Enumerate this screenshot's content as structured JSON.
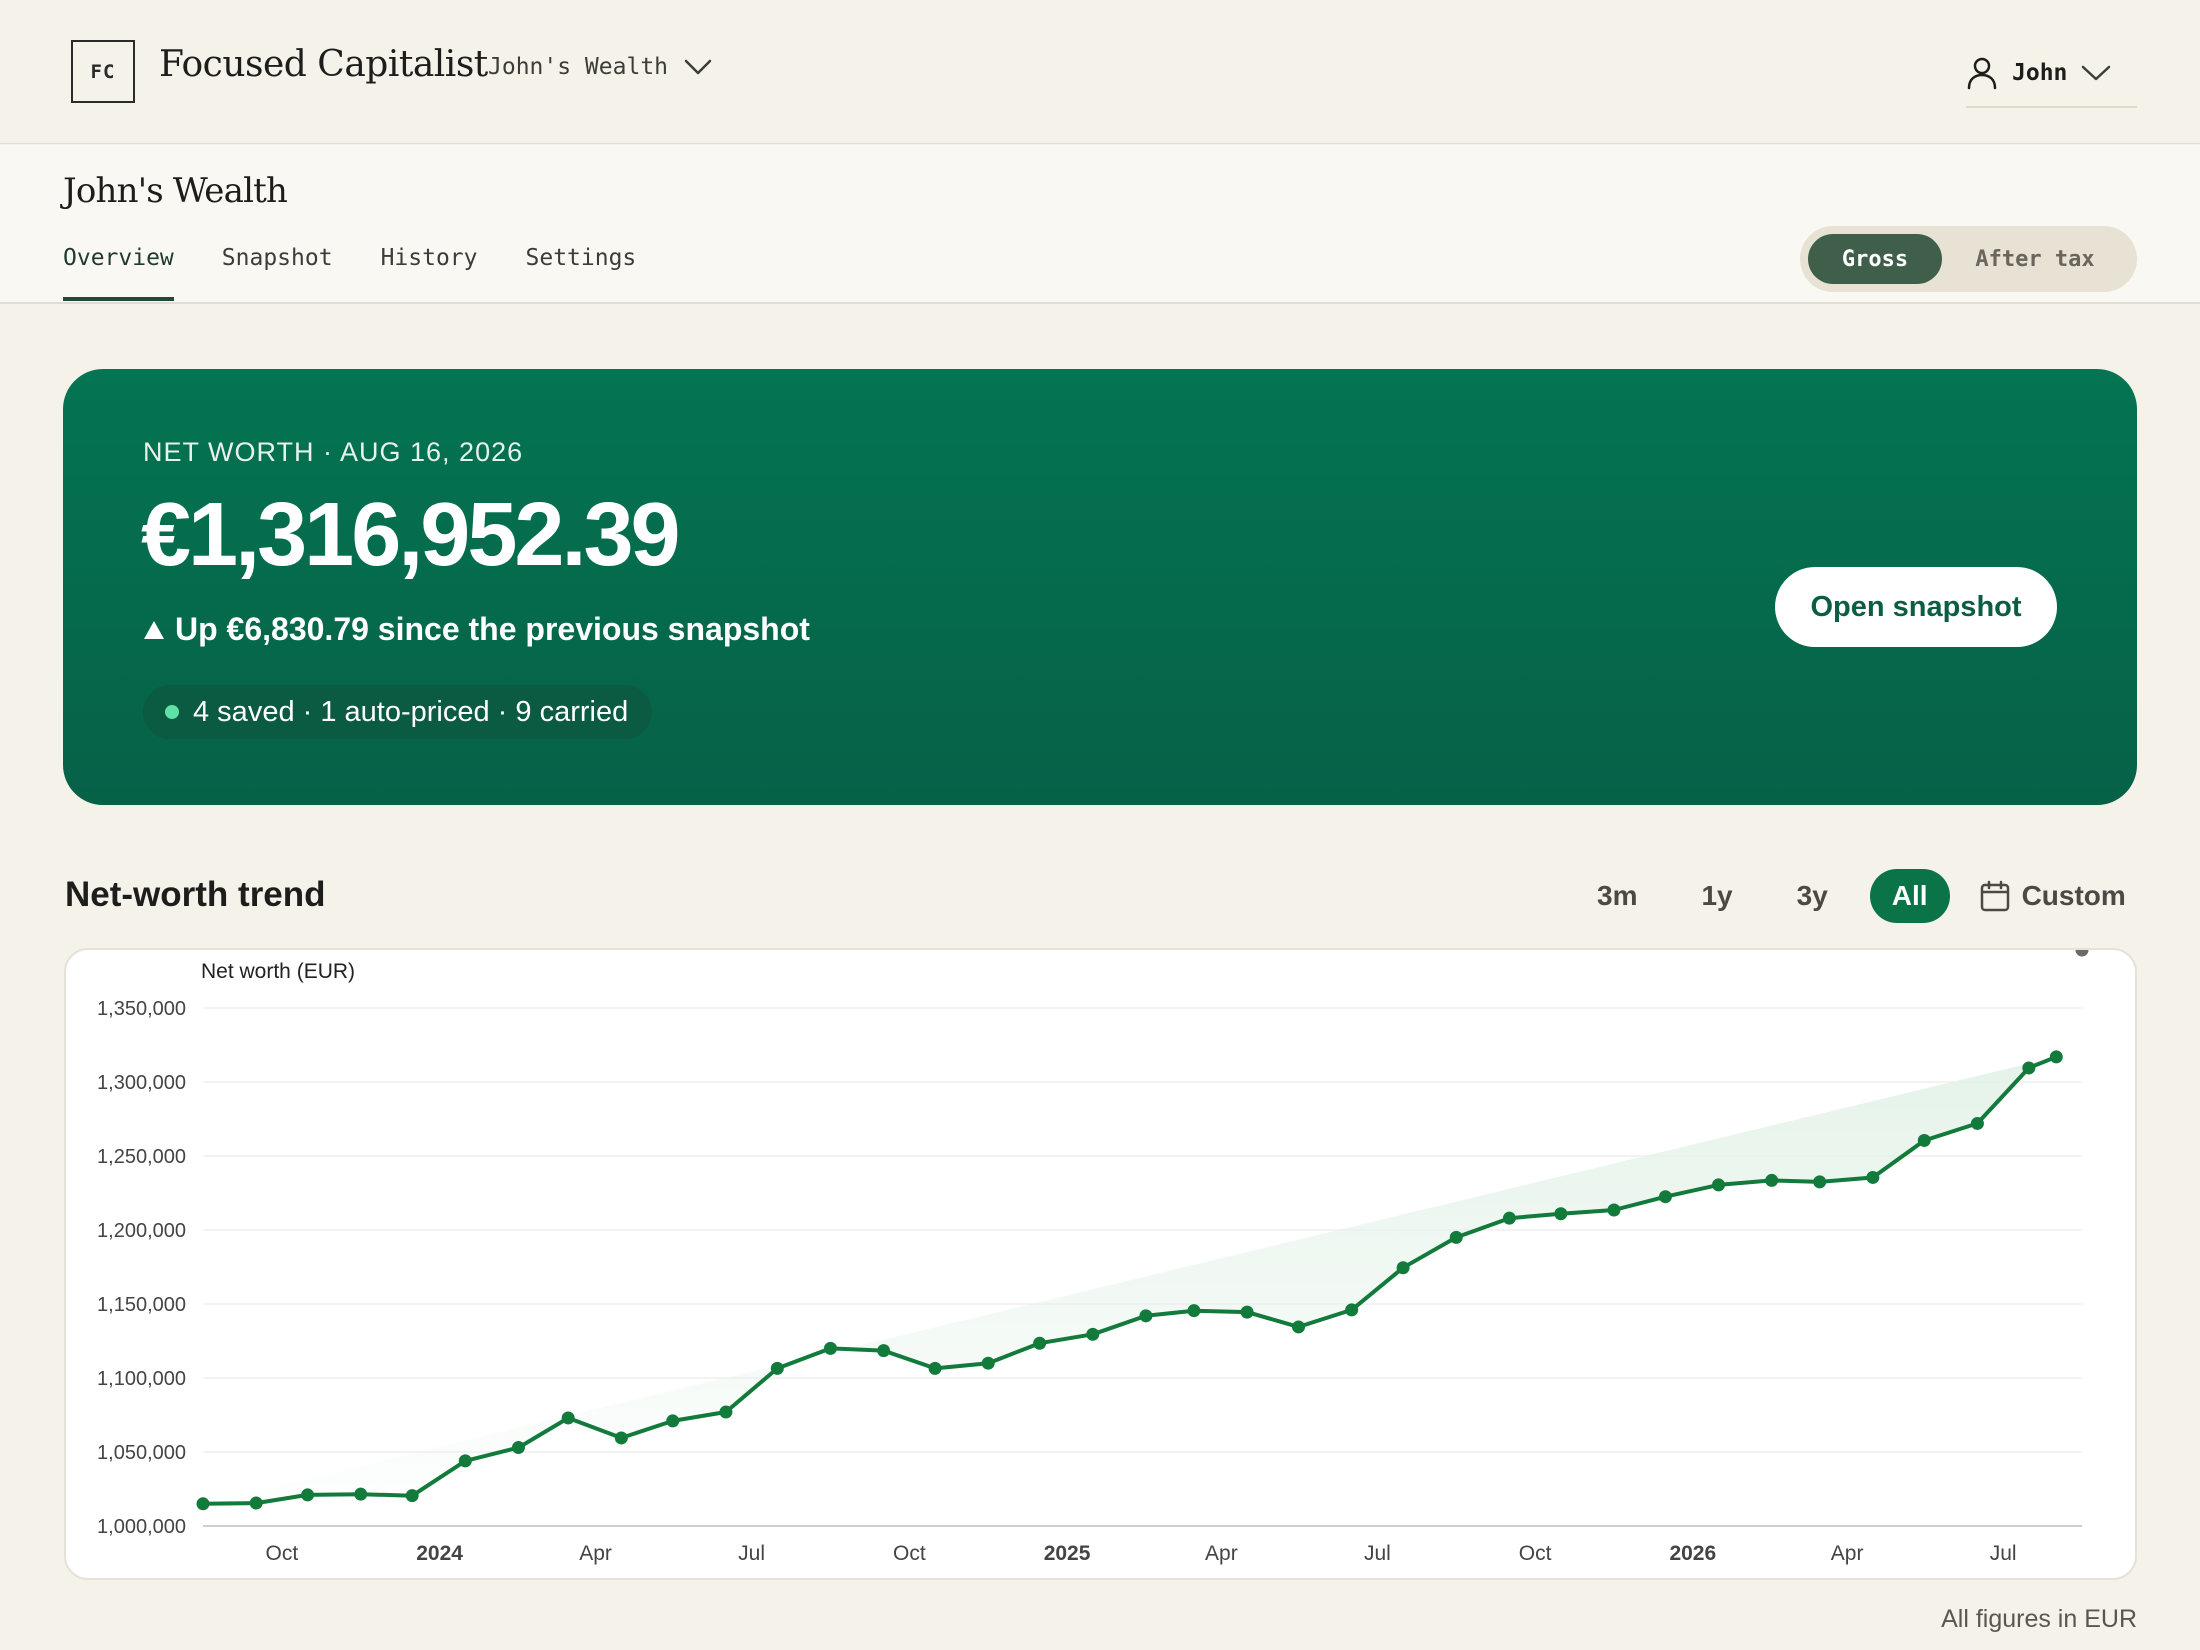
{
  "header": {
    "logo_text": "FC",
    "brand": "Focused Capitalist",
    "wealth_selector": "John's Wealth",
    "user_name": "John"
  },
  "subheader": {
    "title": "John's Wealth",
    "tabs": [
      {
        "label": "Overview",
        "active": true
      },
      {
        "label": "Snapshot",
        "active": false
      },
      {
        "label": "History",
        "active": false
      },
      {
        "label": "Settings",
        "active": false
      }
    ],
    "toggle": {
      "gross": "Gross",
      "after_tax": "After tax",
      "selected": "Gross"
    }
  },
  "hero": {
    "label": "NET WORTH · AUG 16, 2026",
    "value": "€1,316,952.39",
    "change_icon": "triangle-up-icon",
    "change_text": "Up €6,830.79 since the previous snapshot",
    "status_text": "4 saved · 1 auto-priced · 9 carried",
    "open_button": "Open snapshot"
  },
  "trend": {
    "title": "Net-worth trend",
    "ranges": [
      {
        "label": "3m",
        "active": false
      },
      {
        "label": "1y",
        "active": false
      },
      {
        "label": "3y",
        "active": false
      },
      {
        "label": "All",
        "active": true
      }
    ],
    "custom_label": "Custom"
  },
  "chart_data": {
    "type": "area",
    "ylabel": "Net worth (EUR)",
    "ylim": [
      1000000,
      1350000
    ],
    "yticks": [
      1000000,
      1050000,
      1100000,
      1150000,
      1200000,
      1250000,
      1300000,
      1350000
    ],
    "ytick_labels": [
      "1,000,000",
      "1,050,000",
      "1,100,000",
      "1,150,000",
      "1,200,000",
      "1,250,000",
      "1,300,000",
      "1,350,000"
    ],
    "xlim": [
      "2023-08-16",
      "2026-08-16"
    ],
    "xticks": [
      {
        "date": "2023-10-01",
        "label": "Oct",
        "bold": false
      },
      {
        "date": "2024-01-01",
        "label": "2024",
        "bold": true
      },
      {
        "date": "2024-04-01",
        "label": "Apr",
        "bold": false
      },
      {
        "date": "2024-07-01",
        "label": "Jul",
        "bold": false
      },
      {
        "date": "2024-10-01",
        "label": "Oct",
        "bold": false
      },
      {
        "date": "2025-01-01",
        "label": "2025",
        "bold": true
      },
      {
        "date": "2025-04-01",
        "label": "Apr",
        "bold": false
      },
      {
        "date": "2025-07-01",
        "label": "Jul",
        "bold": false
      },
      {
        "date": "2025-10-01",
        "label": "Oct",
        "bold": false
      },
      {
        "date": "2026-01-01",
        "label": "2026",
        "bold": true
      },
      {
        "date": "2026-04-01",
        "label": "Apr",
        "bold": false
      },
      {
        "date": "2026-07-01",
        "label": "Jul",
        "bold": false
      }
    ],
    "grid": true,
    "line_color": "#127a3a",
    "fill_color": "#e3f2e8",
    "last_point_color": "#6b6b6b",
    "x": [
      "2023-08-16",
      "2023-09-16",
      "2023-10-16",
      "2023-11-16",
      "2023-12-16",
      "2024-01-16",
      "2024-02-16",
      "2024-03-16",
      "2024-04-16",
      "2024-05-16",
      "2024-06-16",
      "2024-07-16",
      "2024-08-16",
      "2024-09-16",
      "2024-10-16",
      "2024-11-16",
      "2024-12-16",
      "2025-01-16",
      "2025-02-16",
      "2025-03-16",
      "2025-04-16",
      "2025-05-16",
      "2025-06-16",
      "2025-07-16",
      "2025-08-16",
      "2025-09-16",
      "2025-10-16",
      "2025-11-16",
      "2025-12-16",
      "2026-01-16",
      "2026-02-16",
      "2026-03-16",
      "2026-04-16",
      "2026-05-16",
      "2026-06-16",
      "2026-07-16",
      "2026-08-01",
      "2026-08-16"
    ],
    "values": [
      1015000,
      1015500,
      1021000,
      1021500,
      1020500,
      1044000,
      1053000,
      1073000,
      1059500,
      1071000,
      1077000,
      1106500,
      1120000,
      1118500,
      1106500,
      1110000,
      1123500,
      1129500,
      1142000,
      1145500,
      1144500,
      1134500,
      1146000,
      1174500,
      1195000,
      1208000,
      1211000,
      1213500,
      1222500,
      1230500,
      1233500,
      1232500,
      1235500,
      1260500,
      1272000,
      1309500,
      1316952.39
    ]
  },
  "footnote": "All figures in EUR"
}
